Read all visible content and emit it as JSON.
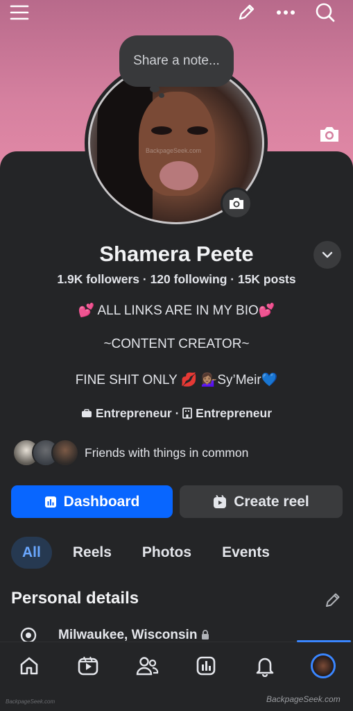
{
  "header": {
    "menu_icon": "hamburger-icon",
    "edit_icon": "pencil-icon",
    "more_icon": "ellipsis-icon",
    "search_icon": "search-icon"
  },
  "note": {
    "placeholder": "Share a note..."
  },
  "profile": {
    "name": "Shamera Peete",
    "stats": "1.9K followers · 120 following · 15K posts",
    "bio_line1": "💕 ALL LINKS ARE IN MY BIO💕",
    "bio_line2": "~CONTENT CREATOR~",
    "bio_line3": "FINE SHIT ONLY 💋 💁🏽‍♀️Sy’Meir💙",
    "work1": "Entrepreneur",
    "work_sep": " · ",
    "work2": "Entrepreneur",
    "avatar_watermark": "BackpageSeek.com"
  },
  "friends": {
    "label": "Friends with things in common"
  },
  "actions": {
    "dashboard_label": "Dashboard",
    "create_reel_label": "Create reel"
  },
  "tabs": [
    {
      "label": "All",
      "active": true
    },
    {
      "label": "Reels",
      "active": false
    },
    {
      "label": "Photos",
      "active": false
    },
    {
      "label": "Events",
      "active": false
    }
  ],
  "personal_details": {
    "title": "Personal details",
    "location": "Milwaukee, Wisconsin"
  },
  "bottom_nav": [
    "home-icon",
    "video-icon",
    "friends-icon",
    "dashboard-icon",
    "bell-icon",
    "profile-avatar"
  ],
  "watermarks": {
    "left": "BackpageSeek.com",
    "right": "BackpageSeek.com"
  },
  "colors": {
    "accent": "#0866ff",
    "tab_active_bg": "#263951",
    "tab_active_text": "#6aa8ff",
    "background": "#242527"
  }
}
